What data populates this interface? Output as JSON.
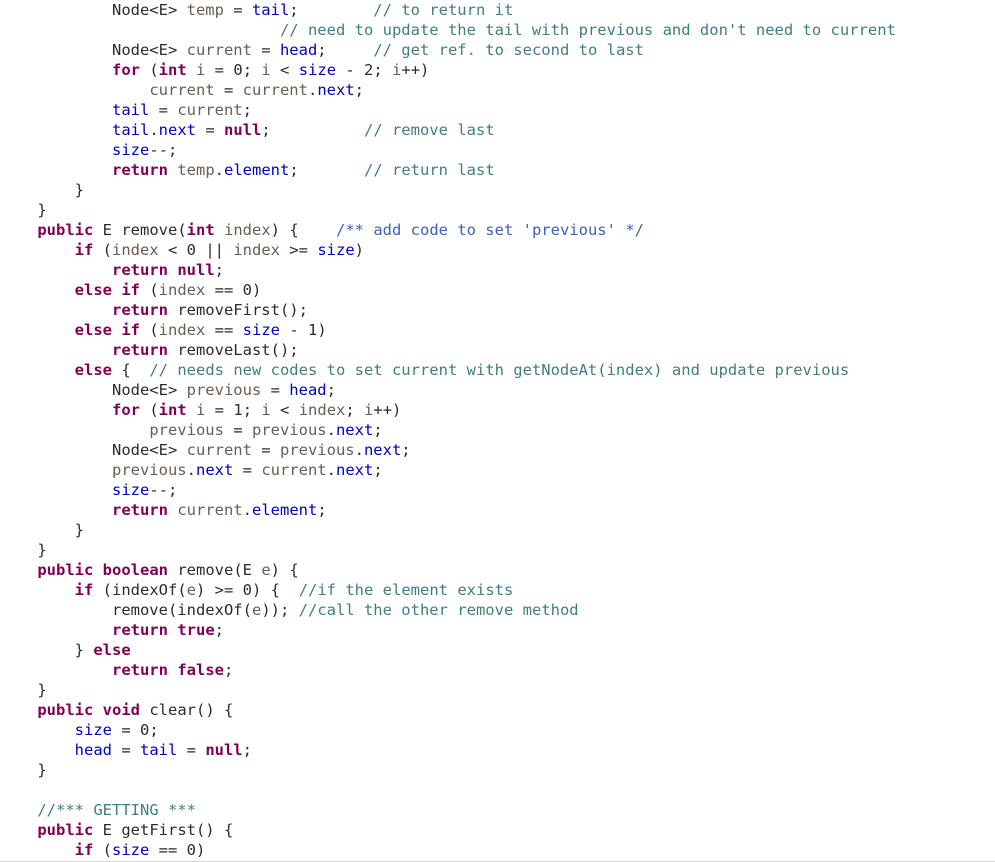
{
  "editor": {
    "language": "Java",
    "font_size_px": 15.5,
    "line_height_px": 20,
    "background": "#ffffff",
    "bottom_border": "#d8d8d8"
  },
  "colors": {
    "keyword": "#7f0055",
    "field": "#0000c0",
    "plain": "#2b2b2b",
    "local_variable": "#6a5d55",
    "line_comment": "#3f7f7f",
    "javadoc_comment": "#3f5fbf",
    "spellcheck_squiggle": "#e8682a"
  },
  "code": {
    "lines": [
      {
        "indent": 3,
        "tokens": [
          {
            "t": "plain",
            "v": "Node<E> "
          },
          {
            "t": "lvar",
            "v": "temp"
          },
          {
            "t": "plain",
            "v": " = "
          },
          {
            "t": "fld",
            "v": "tail"
          },
          {
            "t": "plain",
            "v": ";"
          },
          {
            "t": "pad",
            "v": "        "
          },
          {
            "t": "cmt",
            "v": "// to return it"
          }
        ]
      },
      {
        "indent": 0,
        "tokens": [
          {
            "t": "pad",
            "v": "                              "
          },
          {
            "t": "cmt",
            "v": "// need to update the tail with previous and don't need to current"
          }
        ]
      },
      {
        "indent": 3,
        "tokens": [
          {
            "t": "plain",
            "v": "Node<E> "
          },
          {
            "t": "lvar",
            "v": "current"
          },
          {
            "t": "plain",
            "v": " = "
          },
          {
            "t": "fld",
            "v": "head"
          },
          {
            "t": "plain",
            "v": ";"
          },
          {
            "t": "pad",
            "v": "     "
          },
          {
            "t": "cmt",
            "v": "// get "
          },
          {
            "t": "cmt-spell",
            "v": "ref."
          },
          {
            "t": "cmt",
            "v": " to second to last"
          }
        ]
      },
      {
        "indent": 3,
        "tokens": [
          {
            "t": "kw",
            "v": "for"
          },
          {
            "t": "plain",
            "v": " ("
          },
          {
            "t": "kw",
            "v": "int"
          },
          {
            "t": "plain",
            "v": " "
          },
          {
            "t": "lvar",
            "v": "i"
          },
          {
            "t": "plain",
            "v": " = "
          },
          {
            "t": "num",
            "v": "0"
          },
          {
            "t": "plain",
            "v": "; "
          },
          {
            "t": "lvar",
            "v": "i"
          },
          {
            "t": "plain",
            "v": " < "
          },
          {
            "t": "fld",
            "v": "size"
          },
          {
            "t": "plain",
            "v": " - "
          },
          {
            "t": "num",
            "v": "2"
          },
          {
            "t": "plain",
            "v": "; "
          },
          {
            "t": "lvar",
            "v": "i"
          },
          {
            "t": "plain",
            "v": "++)"
          }
        ]
      },
      {
        "indent": 4,
        "tokens": [
          {
            "t": "lvar",
            "v": "current"
          },
          {
            "t": "plain",
            "v": " = "
          },
          {
            "t": "lvar",
            "v": "current"
          },
          {
            "t": "plain",
            "v": "."
          },
          {
            "t": "fld",
            "v": "next"
          },
          {
            "t": "plain",
            "v": ";"
          }
        ]
      },
      {
        "indent": 3,
        "tokens": [
          {
            "t": "fld",
            "v": "tail"
          },
          {
            "t": "plain",
            "v": " = "
          },
          {
            "t": "lvar",
            "v": "current"
          },
          {
            "t": "plain",
            "v": ";"
          }
        ]
      },
      {
        "indent": 3,
        "tokens": [
          {
            "t": "fld",
            "v": "tail"
          },
          {
            "t": "plain",
            "v": "."
          },
          {
            "t": "fld",
            "v": "next"
          },
          {
            "t": "plain",
            "v": " = "
          },
          {
            "t": "kw",
            "v": "null"
          },
          {
            "t": "plain",
            "v": ";"
          },
          {
            "t": "pad",
            "v": "          "
          },
          {
            "t": "cmt",
            "v": "// remove last"
          }
        ]
      },
      {
        "indent": 3,
        "tokens": [
          {
            "t": "fld",
            "v": "size"
          },
          {
            "t": "plain",
            "v": "--;"
          }
        ]
      },
      {
        "indent": 3,
        "tokens": [
          {
            "t": "kw",
            "v": "return"
          },
          {
            "t": "plain",
            "v": " "
          },
          {
            "t": "lvar",
            "v": "temp"
          },
          {
            "t": "plain",
            "v": "."
          },
          {
            "t": "fld",
            "v": "element"
          },
          {
            "t": "plain",
            "v": ";"
          },
          {
            "t": "pad",
            "v": "       "
          },
          {
            "t": "cmt",
            "v": "// return last"
          }
        ]
      },
      {
        "indent": 2,
        "tokens": [
          {
            "t": "plain",
            "v": "}"
          }
        ]
      },
      {
        "indent": 1,
        "tokens": [
          {
            "t": "plain",
            "v": "}"
          }
        ]
      },
      {
        "indent": 1,
        "tokens": [
          {
            "t": "kw",
            "v": "public"
          },
          {
            "t": "plain",
            "v": " E remove("
          },
          {
            "t": "kw",
            "v": "int"
          },
          {
            "t": "plain",
            "v": " "
          },
          {
            "t": "lvar",
            "v": "index"
          },
          {
            "t": "plain",
            "v": ") {"
          },
          {
            "t": "pad",
            "v": "    "
          },
          {
            "t": "jdoc",
            "v": "/** add code to set 'previous' */"
          }
        ]
      },
      {
        "indent": 2,
        "tokens": [
          {
            "t": "kw",
            "v": "if"
          },
          {
            "t": "plain",
            "v": " ("
          },
          {
            "t": "lvar",
            "v": "index"
          },
          {
            "t": "plain",
            "v": " < "
          },
          {
            "t": "num",
            "v": "0"
          },
          {
            "t": "plain",
            "v": " || "
          },
          {
            "t": "lvar",
            "v": "index"
          },
          {
            "t": "plain",
            "v": " >= "
          },
          {
            "t": "fld",
            "v": "size"
          },
          {
            "t": "plain",
            "v": ")"
          }
        ]
      },
      {
        "indent": 3,
        "tokens": [
          {
            "t": "kw",
            "v": "return"
          },
          {
            "t": "plain",
            "v": " "
          },
          {
            "t": "kw",
            "v": "null"
          },
          {
            "t": "plain",
            "v": ";"
          }
        ]
      },
      {
        "indent": 2,
        "tokens": [
          {
            "t": "kw",
            "v": "else if"
          },
          {
            "t": "plain",
            "v": " ("
          },
          {
            "t": "lvar",
            "v": "index"
          },
          {
            "t": "plain",
            "v": " == "
          },
          {
            "t": "num",
            "v": "0"
          },
          {
            "t": "plain",
            "v": ")"
          }
        ]
      },
      {
        "indent": 3,
        "tokens": [
          {
            "t": "kw",
            "v": "return"
          },
          {
            "t": "plain",
            "v": " removeFirst();"
          }
        ]
      },
      {
        "indent": 2,
        "tokens": [
          {
            "t": "kw",
            "v": "else if"
          },
          {
            "t": "plain",
            "v": " ("
          },
          {
            "t": "lvar",
            "v": "index"
          },
          {
            "t": "plain",
            "v": " == "
          },
          {
            "t": "fld",
            "v": "size"
          },
          {
            "t": "plain",
            "v": " - "
          },
          {
            "t": "num",
            "v": "1"
          },
          {
            "t": "plain",
            "v": ")"
          }
        ]
      },
      {
        "indent": 3,
        "tokens": [
          {
            "t": "kw",
            "v": "return"
          },
          {
            "t": "plain",
            "v": " removeLast();"
          }
        ]
      },
      {
        "indent": 2,
        "tokens": [
          {
            "t": "kw",
            "v": "else"
          },
          {
            "t": "plain",
            "v": " {"
          },
          {
            "t": "pad",
            "v": "  "
          },
          {
            "t": "cmt",
            "v": "// needs new codes to set current with getNodeAt(index) and update previous"
          }
        ]
      },
      {
        "indent": 3,
        "tokens": [
          {
            "t": "plain",
            "v": "Node<E> "
          },
          {
            "t": "lvar",
            "v": "previous"
          },
          {
            "t": "plain",
            "v": " = "
          },
          {
            "t": "fld",
            "v": "head"
          },
          {
            "t": "plain",
            "v": ";"
          }
        ]
      },
      {
        "indent": 3,
        "tokens": [
          {
            "t": "kw",
            "v": "for"
          },
          {
            "t": "plain",
            "v": " ("
          },
          {
            "t": "kw",
            "v": "int"
          },
          {
            "t": "plain",
            "v": " "
          },
          {
            "t": "lvar",
            "v": "i"
          },
          {
            "t": "plain",
            "v": " = "
          },
          {
            "t": "num",
            "v": "1"
          },
          {
            "t": "plain",
            "v": "; "
          },
          {
            "t": "lvar",
            "v": "i"
          },
          {
            "t": "plain",
            "v": " < "
          },
          {
            "t": "lvar",
            "v": "index"
          },
          {
            "t": "plain",
            "v": "; "
          },
          {
            "t": "lvar",
            "v": "i"
          },
          {
            "t": "plain",
            "v": "++)"
          }
        ]
      },
      {
        "indent": 4,
        "tokens": [
          {
            "t": "lvar",
            "v": "previous"
          },
          {
            "t": "plain",
            "v": " = "
          },
          {
            "t": "lvar",
            "v": "previous"
          },
          {
            "t": "plain",
            "v": "."
          },
          {
            "t": "fld",
            "v": "next"
          },
          {
            "t": "plain",
            "v": ";"
          }
        ]
      },
      {
        "indent": 3,
        "tokens": [
          {
            "t": "plain",
            "v": "Node<E> "
          },
          {
            "t": "lvar",
            "v": "current"
          },
          {
            "t": "plain",
            "v": " = "
          },
          {
            "t": "lvar",
            "v": "previous"
          },
          {
            "t": "plain",
            "v": "."
          },
          {
            "t": "fld",
            "v": "next"
          },
          {
            "t": "plain",
            "v": ";"
          }
        ]
      },
      {
        "indent": 3,
        "tokens": [
          {
            "t": "lvar",
            "v": "previous"
          },
          {
            "t": "plain",
            "v": "."
          },
          {
            "t": "fld",
            "v": "next"
          },
          {
            "t": "plain",
            "v": " = "
          },
          {
            "t": "lvar",
            "v": "current"
          },
          {
            "t": "plain",
            "v": "."
          },
          {
            "t": "fld",
            "v": "next"
          },
          {
            "t": "plain",
            "v": ";"
          }
        ]
      },
      {
        "indent": 3,
        "tokens": [
          {
            "t": "fld",
            "v": "size"
          },
          {
            "t": "plain",
            "v": "--;"
          }
        ]
      },
      {
        "indent": 3,
        "tokens": [
          {
            "t": "kw",
            "v": "return"
          },
          {
            "t": "plain",
            "v": " "
          },
          {
            "t": "lvar",
            "v": "current"
          },
          {
            "t": "plain",
            "v": "."
          },
          {
            "t": "fld",
            "v": "element"
          },
          {
            "t": "plain",
            "v": ";"
          }
        ]
      },
      {
        "indent": 2,
        "tokens": [
          {
            "t": "plain",
            "v": "}"
          }
        ]
      },
      {
        "indent": 1,
        "tokens": [
          {
            "t": "plain",
            "v": "}"
          }
        ]
      },
      {
        "indent": 1,
        "tokens": [
          {
            "t": "kw",
            "v": "public"
          },
          {
            "t": "plain",
            "v": " "
          },
          {
            "t": "kw",
            "v": "boolean"
          },
          {
            "t": "plain",
            "v": " remove(E "
          },
          {
            "t": "lvar",
            "v": "e"
          },
          {
            "t": "plain",
            "v": ") {"
          }
        ]
      },
      {
        "indent": 2,
        "tokens": [
          {
            "t": "kw",
            "v": "if"
          },
          {
            "t": "plain",
            "v": " (indexOf("
          },
          {
            "t": "lvar",
            "v": "e"
          },
          {
            "t": "plain",
            "v": ") >= "
          },
          {
            "t": "num",
            "v": "0"
          },
          {
            "t": "plain",
            "v": ") {"
          },
          {
            "t": "pad",
            "v": "  "
          },
          {
            "t": "cmt",
            "v": "//if the element exists"
          }
        ]
      },
      {
        "indent": 3,
        "tokens": [
          {
            "t": "plain",
            "v": "remove(indexOf("
          },
          {
            "t": "lvar",
            "v": "e"
          },
          {
            "t": "plain",
            "v": "));"
          },
          {
            "t": "pad",
            "v": " "
          },
          {
            "t": "cmt",
            "v": "//call the other remove method"
          }
        ]
      },
      {
        "indent": 3,
        "tokens": [
          {
            "t": "kw",
            "v": "return"
          },
          {
            "t": "plain",
            "v": " "
          },
          {
            "t": "kw",
            "v": "true"
          },
          {
            "t": "plain",
            "v": ";"
          }
        ]
      },
      {
        "indent": 2,
        "tokens": [
          {
            "t": "plain",
            "v": "} "
          },
          {
            "t": "kw",
            "v": "else"
          }
        ]
      },
      {
        "indent": 3,
        "tokens": [
          {
            "t": "kw",
            "v": "return"
          },
          {
            "t": "plain",
            "v": " "
          },
          {
            "t": "kw",
            "v": "false"
          },
          {
            "t": "plain",
            "v": ";"
          }
        ]
      },
      {
        "indent": 1,
        "tokens": [
          {
            "t": "plain",
            "v": "}"
          }
        ]
      },
      {
        "indent": 1,
        "tokens": [
          {
            "t": "kw",
            "v": "public"
          },
          {
            "t": "plain",
            "v": " "
          },
          {
            "t": "kw",
            "v": "void"
          },
          {
            "t": "plain",
            "v": " clear() {"
          }
        ]
      },
      {
        "indent": 2,
        "tokens": [
          {
            "t": "fld",
            "v": "size"
          },
          {
            "t": "plain",
            "v": " = "
          },
          {
            "t": "num",
            "v": "0"
          },
          {
            "t": "plain",
            "v": ";"
          }
        ]
      },
      {
        "indent": 2,
        "tokens": [
          {
            "t": "fld",
            "v": "head"
          },
          {
            "t": "plain",
            "v": " = "
          },
          {
            "t": "fld",
            "v": "tail"
          },
          {
            "t": "plain",
            "v": " = "
          },
          {
            "t": "kw",
            "v": "null"
          },
          {
            "t": "plain",
            "v": ";"
          }
        ]
      },
      {
        "indent": 1,
        "tokens": [
          {
            "t": "plain",
            "v": "}"
          }
        ]
      },
      {
        "indent": 0,
        "tokens": []
      },
      {
        "indent": 1,
        "tokens": [
          {
            "t": "cmt",
            "v": "//*** GETTING ***"
          }
        ]
      },
      {
        "indent": 1,
        "tokens": [
          {
            "t": "kw",
            "v": "public"
          },
          {
            "t": "plain",
            "v": " E getFirst() {"
          }
        ]
      },
      {
        "indent": 2,
        "tokens": [
          {
            "t": "kw",
            "v": "if"
          },
          {
            "t": "plain",
            "v": " ("
          },
          {
            "t": "fld",
            "v": "size"
          },
          {
            "t": "plain",
            "v": " == "
          },
          {
            "t": "num",
            "v": "0"
          },
          {
            "t": "plain",
            "v": ")"
          }
        ]
      }
    ]
  }
}
